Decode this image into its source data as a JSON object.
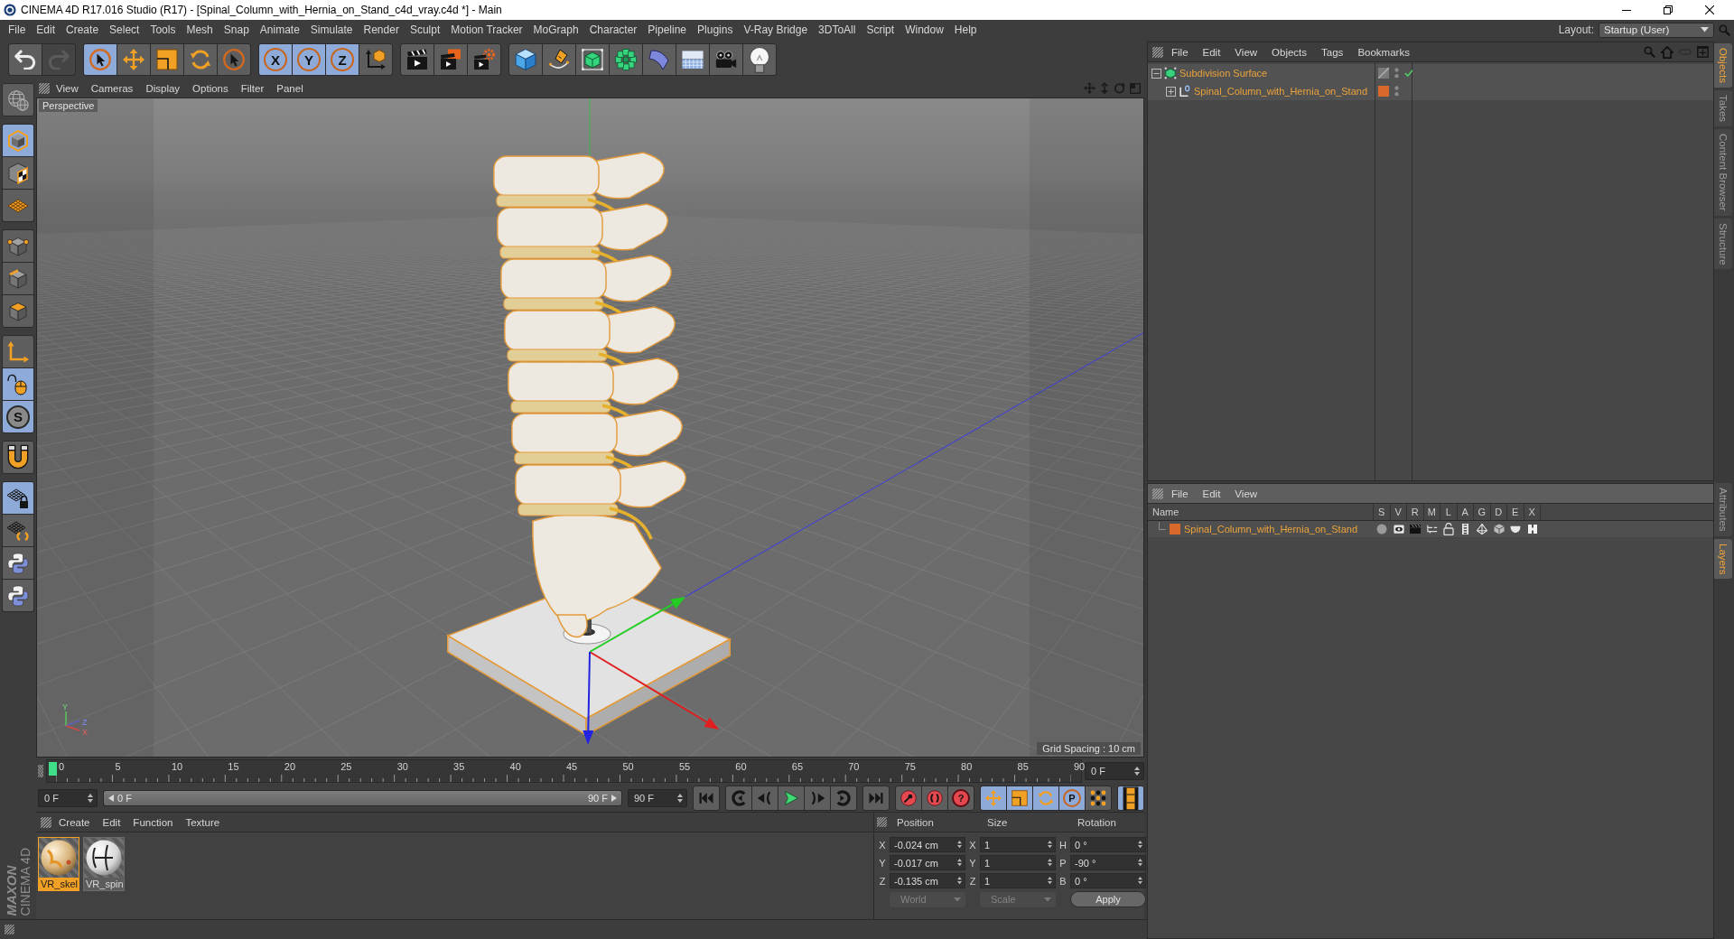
{
  "window": {
    "title": "CINEMA 4D R17.016 Studio (R17) - [Spinal_Column_with_Hernia_on_Stand_c4d_vray.c4d *] - Main"
  },
  "menu_bar": {
    "items": [
      "File",
      "Edit",
      "Create",
      "Select",
      "Tools",
      "Mesh",
      "Snap",
      "Animate",
      "Simulate",
      "Render",
      "Sculpt",
      "Motion Tracker",
      "MoGraph",
      "Character",
      "Pipeline",
      "Plugins",
      "V-Ray Bridge",
      "3DToAll",
      "Script",
      "Window",
      "Help"
    ],
    "layout_label": "Layout:",
    "layout_value": "Startup (User)"
  },
  "toolbar": {
    "groups": [
      {
        "buttons": [
          {
            "kind": "undo",
            "active": false,
            "disabled": false
          },
          {
            "kind": "redo",
            "active": false,
            "disabled": true
          }
        ]
      },
      {
        "buttons": [
          {
            "kind": "select",
            "active": true
          },
          {
            "kind": "move",
            "active": false
          },
          {
            "kind": "scale",
            "active": false
          },
          {
            "kind": "rotate",
            "active": false
          },
          {
            "kind": "select",
            "active": false
          }
        ]
      },
      {
        "buttons": [
          {
            "kind": "axis",
            "label": "X",
            "active": true
          },
          {
            "kind": "axis",
            "label": "Y",
            "active": true
          },
          {
            "kind": "axis",
            "label": "Z",
            "active": true
          },
          {
            "kind": "coord",
            "active": false
          }
        ]
      },
      {
        "buttons": [
          {
            "kind": "render_view",
            "active": false
          },
          {
            "kind": "render_pv",
            "active": false
          },
          {
            "kind": "render_settings",
            "active": false
          }
        ]
      },
      {
        "buttons": [
          {
            "kind": "cube",
            "active": false
          },
          {
            "kind": "pen",
            "active": false
          },
          {
            "kind": "subdivision",
            "active": false
          },
          {
            "kind": "cloner",
            "active": false
          },
          {
            "kind": "bend",
            "active": false
          },
          {
            "kind": "floor",
            "active": false
          },
          {
            "kind": "camera",
            "active": false
          },
          {
            "kind": "light",
            "active": false
          }
        ]
      }
    ]
  },
  "left_toolbar": {
    "groups": [
      {
        "buttons": [
          {
            "kind": "make_editable",
            "active": false
          }
        ]
      },
      {
        "buttons": [
          {
            "kind": "model",
            "active": true
          },
          {
            "kind": "texture",
            "active": false
          },
          {
            "kind": "workplane",
            "active": false
          }
        ]
      },
      {
        "buttons": [
          {
            "kind": "points",
            "active": false
          },
          {
            "kind": "edges",
            "active": false
          },
          {
            "kind": "polygons",
            "active": false
          }
        ]
      },
      {
        "buttons": [
          {
            "kind": "axis_mode",
            "active": false
          },
          {
            "kind": "tweak",
            "active": true
          },
          {
            "kind": "snap",
            "label": "S",
            "active": true
          }
        ]
      },
      {
        "buttons": [
          {
            "kind": "magnet",
            "active": false
          }
        ]
      },
      {
        "buttons": [
          {
            "kind": "lock_workplane",
            "active": true
          },
          {
            "kind": "rotate_workplane",
            "active": false
          },
          {
            "kind": "python",
            "active": false
          },
          {
            "kind": "python",
            "active": false
          }
        ]
      }
    ]
  },
  "viewport": {
    "menu": [
      "View",
      "Cameras",
      "Display",
      "Options",
      "Filter",
      "Panel"
    ],
    "camera": "Perspective",
    "grid_spacing": "Grid Spacing : 10 cm",
    "axis_labels": [
      "Y",
      "Z",
      "X"
    ]
  },
  "timeline": {
    "ticks": [
      "0",
      "5",
      "10",
      "15",
      "20",
      "25",
      "30",
      "35",
      "40",
      "45",
      "50",
      "55",
      "60",
      "65",
      "70",
      "75",
      "80",
      "85",
      "90"
    ],
    "level": 0,
    "frame_field": "0 F"
  },
  "transport": {
    "start_field": "0 F",
    "range": {
      "start": "0 F",
      "end": "90 F",
      "level": 1
    },
    "end_field": "90 F",
    "groups": [
      {
        "buttons": [
          {
            "kind": "first"
          }
        ]
      },
      {
        "buttons": [
          {
            "kind": "prev_key"
          },
          {
            "kind": "prev_frame"
          },
          {
            "kind": "play"
          },
          {
            "kind": "next_frame"
          },
          {
            "kind": "next_key"
          }
        ]
      },
      {
        "buttons": [
          {
            "kind": "last"
          }
        ]
      },
      {
        "buttons": [
          {
            "kind": "record"
          },
          {
            "kind": "autokey"
          },
          {
            "kind": "help",
            "label": "?"
          }
        ]
      },
      {
        "buttons": [
          {
            "kind": "move",
            "active": true
          },
          {
            "kind": "scale",
            "active": true
          },
          {
            "kind": "rotate",
            "active": true
          },
          {
            "kind": "param",
            "label": "P",
            "active": true
          },
          {
            "kind": "pla",
            "active": false
          }
        ]
      },
      {
        "buttons": [
          {
            "kind": "film",
            "active": true
          }
        ]
      }
    ]
  },
  "material_manager": {
    "menu": [
      "Create",
      "Edit",
      "Function",
      "Texture"
    ],
    "materials": [
      {
        "name": "VR_skel",
        "kind": "bone",
        "selected": true
      },
      {
        "name": "VR_spin",
        "kind": "white",
        "selected": false
      }
    ]
  },
  "coordinates": {
    "headers": [
      "Position",
      "Size",
      "Rotation"
    ],
    "rows": [
      {
        "cells": [
          {
            "axis": "X",
            "value": "-0.024 cm"
          },
          {
            "axis": "X",
            "value": "1"
          },
          {
            "axis": "H",
            "value": "0 °"
          }
        ]
      },
      {
        "cells": [
          {
            "axis": "Y",
            "value": "-0.017 cm"
          },
          {
            "axis": "Y",
            "value": "1"
          },
          {
            "axis": "P",
            "value": "-90 °"
          }
        ]
      },
      {
        "cells": [
          {
            "axis": "Z",
            "value": "-0.135 cm"
          },
          {
            "axis": "Z",
            "value": "1"
          },
          {
            "axis": "B",
            "value": "0 °"
          }
        ]
      }
    ],
    "dropdowns": [
      {
        "value": "World",
        "disabled": true
      },
      {
        "value": "Scale",
        "disabled": true
      }
    ],
    "apply": "Apply"
  },
  "object_manager": {
    "menu": [
      "File",
      "Edit",
      "View",
      "Objects",
      "Tags",
      "Bookmarks"
    ],
    "objects": [
      {
        "name": "Subdivision Surface",
        "kind": "subdivision",
        "selected": true,
        "expanded": true,
        "enabled": true,
        "children": [
          {
            "name": "Spinal_Column_with_Hernia_on_Stand",
            "kind": "null",
            "selected": true,
            "expanded": false,
            "color": "#d9692b"
          }
        ]
      }
    ]
  },
  "layer_manager": {
    "menu": [
      "File",
      "Edit",
      "View"
    ],
    "columns": [
      "Name",
      "S",
      "V",
      "R",
      "M",
      "L",
      "A",
      "G",
      "D",
      "E",
      "X"
    ],
    "layers": [
      {
        "name": "Spinal_Column_with_Hernia_on_Stand",
        "color": "#d9692b",
        "selected": true
      }
    ]
  },
  "side_tabs": {
    "top": [
      {
        "label": "Objects",
        "selected": true
      },
      {
        "label": "Takes",
        "selected": false
      },
      {
        "label": "Content Browser",
        "selected": false
      },
      {
        "label": "Structure",
        "selected": false
      }
    ],
    "bottom": [
      {
        "label": "Attributes",
        "selected": false
      },
      {
        "label": "Layers",
        "selected": true
      }
    ]
  },
  "logo": {
    "brand": "MAXON",
    "product": "CINEMA 4D"
  }
}
